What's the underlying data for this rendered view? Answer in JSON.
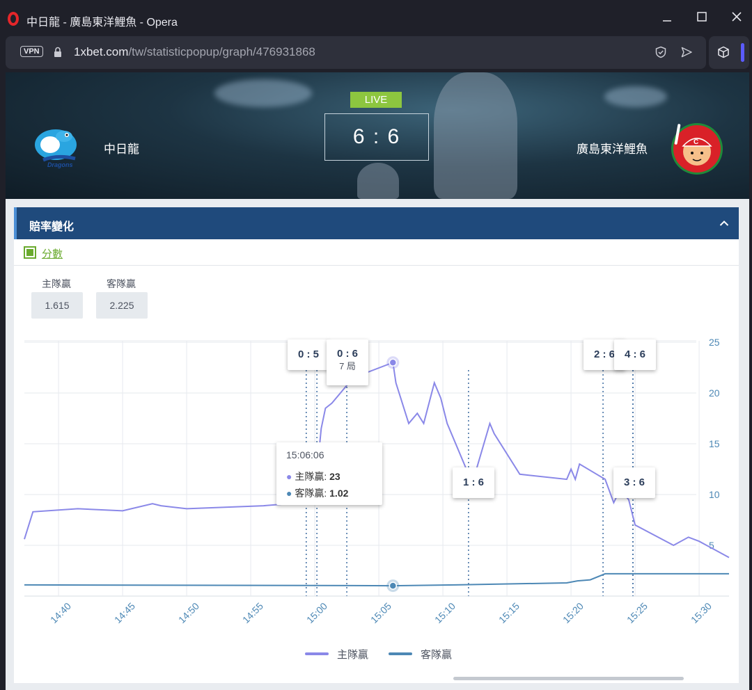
{
  "window": {
    "title": "中日龍 - 廣島東洋鯉魚 - Opera",
    "minimize_icon": "minimize-icon",
    "maximize_icon": "maximize-icon",
    "close_icon": "close-icon"
  },
  "address_bar": {
    "vpn_label": "VPN",
    "url_host": "1xbet.com",
    "url_path": "/tw/statisticpopup/graph/476931868"
  },
  "match": {
    "status": "LIVE",
    "score": "6 : 6",
    "home_team": "中日龍",
    "away_team": "廣島東洋鯉魚"
  },
  "panel": {
    "title": "賠率變化",
    "score_toggle_label": "分數",
    "home_win_label": "主隊贏",
    "home_win_value": "1.615",
    "away_win_label": "客隊贏",
    "away_win_value": "2.225"
  },
  "chart_data": {
    "type": "line",
    "x_ticks": [
      "14:40",
      "14:45",
      "14:50",
      "14:55",
      "15:00",
      "15:05",
      "15:10",
      "15:15",
      "15:20",
      "15:25",
      "15:30"
    ],
    "y_ticks": [
      5,
      10,
      15,
      20,
      25
    ],
    "ylim": [
      0,
      25
    ],
    "grid": true,
    "legend_position": "bottom",
    "series": [
      {
        "name": "主隊贏",
        "color": "#8a88e8",
        "points": [
          [
            "14:37:20",
            5.6
          ],
          [
            "14:38:00",
            8.3
          ],
          [
            "14:41:30",
            8.6
          ],
          [
            "14:45:00",
            8.4
          ],
          [
            "14:47:20",
            9.1
          ],
          [
            "14:48:00",
            8.9
          ],
          [
            "14:50:00",
            8.6
          ],
          [
            "14:56:00",
            8.9
          ],
          [
            "14:58:00",
            9.1
          ],
          [
            "15:00:00",
            10
          ],
          [
            "15:00:30",
            16.5
          ],
          [
            "15:00:50",
            18.5
          ],
          [
            "15:01:20",
            19
          ],
          [
            "15:03:00",
            21.5
          ],
          [
            "15:06:06",
            23
          ],
          [
            "15:06:20",
            21
          ],
          [
            "15:07:20",
            17
          ],
          [
            "15:08:00",
            18
          ],
          [
            "15:08:30",
            17
          ],
          [
            "15:09:20",
            21
          ],
          [
            "15:09:50",
            19.5
          ],
          [
            "15:10:20",
            17
          ],
          [
            "15:11:50",
            12.5
          ],
          [
            "15:12:30",
            12
          ],
          [
            "15:13:40",
            17
          ],
          [
            "15:14:00",
            16
          ],
          [
            "15:16:00",
            12
          ],
          [
            "15:19:40",
            11.5
          ],
          [
            "15:20:00",
            12.5
          ],
          [
            "15:20:20",
            11.5
          ],
          [
            "15:20:40",
            13
          ],
          [
            "15:22:00",
            12
          ],
          [
            "15:22:40",
            11.5
          ],
          [
            "15:23:20",
            9.2
          ],
          [
            "15:23:50",
            10.5
          ],
          [
            "15:24:30",
            9.5
          ],
          [
            "15:25:00",
            7
          ],
          [
            "15:28:00",
            5
          ],
          [
            "15:29:10",
            5.8
          ],
          [
            "15:30:00",
            5.4
          ],
          [
            "15:32:20",
            3.8
          ]
        ]
      },
      {
        "name": "客隊贏",
        "color": "#4d88b5",
        "points": [
          [
            "14:37:20",
            1.1
          ],
          [
            "15:00:00",
            1.05
          ],
          [
            "15:06:06",
            1.02
          ],
          [
            "15:11:00",
            1.1
          ],
          [
            "15:19:40",
            1.3
          ],
          [
            "15:20:30",
            1.5
          ],
          [
            "15:21:30",
            1.6
          ],
          [
            "15:22:40",
            2.2
          ],
          [
            "15:32:20",
            2.2
          ]
        ]
      }
    ],
    "events": [
      {
        "time": "14:59:20",
        "score": "0 : 5"
      },
      {
        "time": "15:00:10",
        "score": "0 : 6"
      },
      {
        "time": "15:02:30",
        "score": "0 : 6",
        "inning": "7 局"
      },
      {
        "time": "15:12:00",
        "score": "1 : 6"
      },
      {
        "time": "15:22:30",
        "score": "2 : 6"
      },
      {
        "time": "15:24:50",
        "score": "3 : 6"
      },
      {
        "time": "15:24:50",
        "score": "4 : 6"
      }
    ],
    "tooltip": {
      "time": "15:06:06",
      "rows": [
        {
          "label": "主隊贏",
          "value": "23"
        },
        {
          "label": "客隊贏",
          "value": "1.02"
        }
      ]
    }
  }
}
